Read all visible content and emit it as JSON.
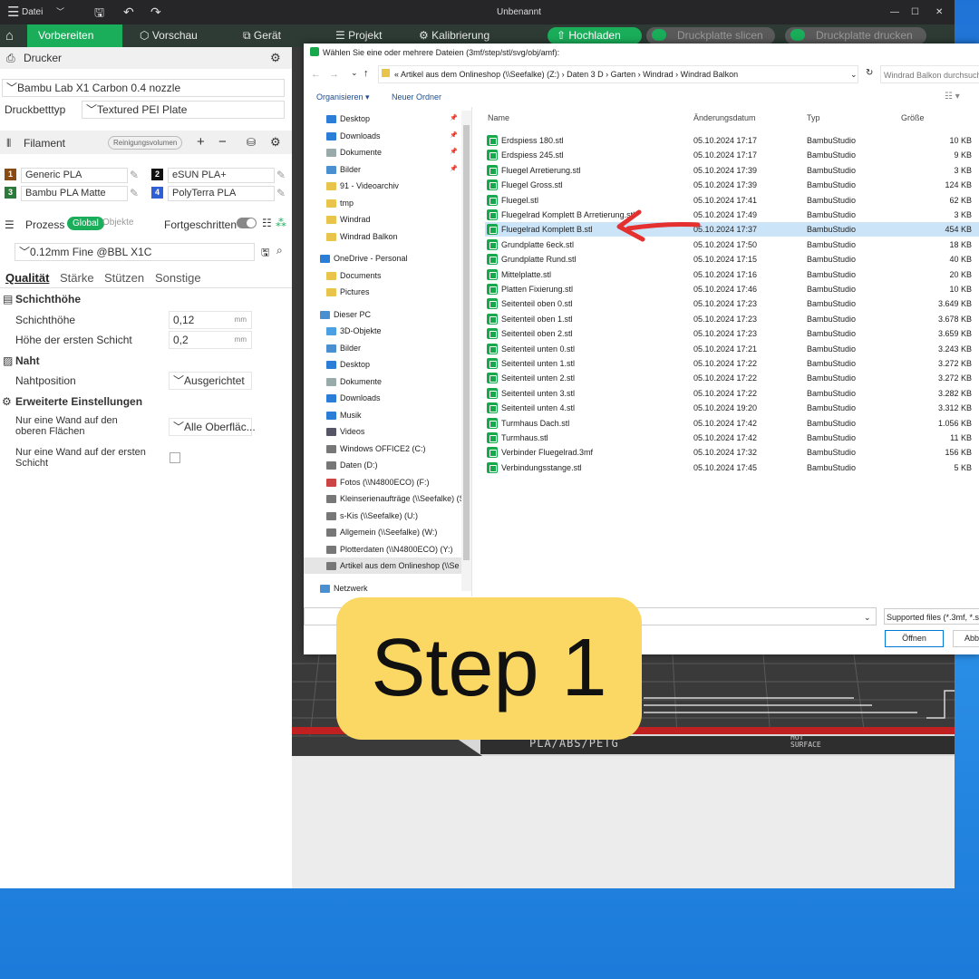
{
  "window": {
    "menu_label": "Datei",
    "title": "Unbenannt"
  },
  "toolbar": {
    "tabs": [
      "Vorbereiten",
      "Vorschau",
      "Gerät",
      "Projekt",
      "Kalibrierung"
    ],
    "upload": "Hochladen",
    "slice": "Druckplatte slicen",
    "print": "Druckplatte drucken"
  },
  "printer": {
    "section": "Drucker",
    "model": "Bambu Lab X1 Carbon 0.4 nozzle",
    "bed_label": "Druckbetttyp",
    "bed_value": "Textured PEI Plate"
  },
  "filament": {
    "section": "Filament",
    "purge": "Reinigungsvolumen",
    "items": [
      {
        "num": "1",
        "name": "Generic PLA",
        "color": "#8a4b12"
      },
      {
        "num": "2",
        "name": "eSUN PLA+",
        "color": "#111111"
      },
      {
        "num": "3",
        "name": "Bambu PLA Matte",
        "color": "#2a7a3a"
      },
      {
        "num": "4",
        "name": "PolyTerra PLA",
        "color": "#2f5fd6"
      }
    ]
  },
  "process": {
    "section": "Prozess",
    "global": "Global",
    "objects": "Objekte",
    "advanced": "Fortgeschritten",
    "preset": "0.12mm Fine @BBL X1C",
    "tabs": [
      "Qualität",
      "Stärke",
      "Stützen",
      "Sonstige"
    ],
    "layer_group": "Schichthöhe",
    "layer_height_label": "Schichthöhe",
    "layer_height": "0,12",
    "first_layer_label": "Höhe der ersten Schicht",
    "first_layer": "0,2",
    "unit": "mm",
    "seam_group": "Naht",
    "seam_label": "Nahtposition",
    "seam_value": "Ausgerichtet",
    "adv_group": "Erweiterte Einstellungen",
    "one_wall_top_label": "Nur eine Wand auf den oberen Flächen",
    "one_wall_top_value": "Alle Oberfläc...",
    "one_wall_first_label": "Nur eine Wand auf der ersten Schicht"
  },
  "plate": {
    "label": "PLA/ABS/PETG",
    "hot": "HOT",
    "surface": "SURFACE"
  },
  "dialog": {
    "title": "Wählen Sie eine oder mehrere Dateien (3mf/step/stl/svg/obj/amf):",
    "breadcrumb": [
      "Artikel aus dem Onlineshop (\\\\Seefalke) (Z:)",
      "Daten 3 D",
      "Garten",
      "Windrad",
      "Windrad Balkon"
    ],
    "search_placeholder": "Windrad Balkon durchsuchen",
    "organize": "Organisieren",
    "new_folder": "Neuer Ordner",
    "columns": [
      "Name",
      "Änderungsdatum",
      "Typ",
      "Größe"
    ],
    "nav": [
      {
        "label": "Desktop",
        "c": "#2a7ed8",
        "i": 0
      },
      {
        "label": "Downloads",
        "c": "#2a7ed8",
        "i": 0
      },
      {
        "label": "Dokumente",
        "c": "#9aa",
        "i": 0
      },
      {
        "label": "Bilder",
        "c": "#4a8fd0",
        "i": 0
      },
      {
        "label": "91 - Videoarchiv",
        "c": "#e8c44a",
        "i": 0
      },
      {
        "label": "tmp",
        "c": "#e8c44a",
        "i": 0
      },
      {
        "label": "Windrad",
        "c": "#e8c44a",
        "i": 0
      },
      {
        "label": "Windrad Balkon",
        "c": "#e8c44a",
        "i": 0
      },
      {
        "label": "",
        "c": "",
        "i": 0
      },
      {
        "label": "OneDrive - Personal",
        "c": "#2a7ed8",
        "i": -1
      },
      {
        "label": "Documents",
        "c": "#e8c44a",
        "i": 0
      },
      {
        "label": "Pictures",
        "c": "#e8c44a",
        "i": 0
      },
      {
        "label": "",
        "c": "",
        "i": 0
      },
      {
        "label": "Dieser PC",
        "c": "#4a8fd0",
        "i": -1
      },
      {
        "label": "3D-Objekte",
        "c": "#4aa0e0",
        "i": 0
      },
      {
        "label": "Bilder",
        "c": "#4a8fd0",
        "i": 0
      },
      {
        "label": "Desktop",
        "c": "#2a7ed8",
        "i": 0
      },
      {
        "label": "Dokumente",
        "c": "#9aa",
        "i": 0
      },
      {
        "label": "Downloads",
        "c": "#2a7ed8",
        "i": 0
      },
      {
        "label": "Musik",
        "c": "#2a7ed8",
        "i": 0
      },
      {
        "label": "Videos",
        "c": "#556",
        "i": 0
      },
      {
        "label": "Windows OFFICE2 (C:)",
        "c": "#777",
        "i": 0
      },
      {
        "label": "Daten (D:)",
        "c": "#777",
        "i": 0
      },
      {
        "label": "Fotos (\\\\N4800ECO) (F:)",
        "c": "#c44",
        "i": 0
      },
      {
        "label": "Kleinserienaufträge (\\\\Seefalke) (S",
        "c": "#777",
        "i": 0
      },
      {
        "label": "s-Kis (\\\\Seefalke) (U:)",
        "c": "#777",
        "i": 0
      },
      {
        "label": "Allgemein (\\\\Seefalke) (W:)",
        "c": "#777",
        "i": 0
      },
      {
        "label": "Plotterdaten (\\\\N4800ECO) (Y:)",
        "c": "#777",
        "i": 0
      },
      {
        "label": "Artikel aus dem Onlineshop (\\\\Se",
        "c": "#777",
        "i": 0
      },
      {
        "label": "",
        "c": "",
        "i": 0
      },
      {
        "label": "Netzwerk",
        "c": "#4a8fd0",
        "i": -1
      }
    ],
    "files": [
      [
        "Erdspiess 180.stl",
        "05.10.2024 17:17",
        "BambuStudio",
        "10 KB"
      ],
      [
        "Erdspiess 245.stl",
        "05.10.2024 17:17",
        "BambuStudio",
        "9 KB"
      ],
      [
        "Fluegel Arretierung.stl",
        "05.10.2024 17:39",
        "BambuStudio",
        "3 KB"
      ],
      [
        "Fluegel Gross.stl",
        "05.10.2024 17:39",
        "BambuStudio",
        "124 KB"
      ],
      [
        "Fluegel.stl",
        "05.10.2024 17:41",
        "BambuStudio",
        "62 KB"
      ],
      [
        "Fluegelrad Komplett B Arretierung.stl",
        "05.10.2024 17:49",
        "BambuStudio",
        "3 KB"
      ],
      [
        "Fluegelrad Komplett B.stl",
        "05.10.2024 17:37",
        "BambuStudio",
        "454 KB"
      ],
      [
        "Grundplatte 6eck.stl",
        "05.10.2024 17:50",
        "BambuStudio",
        "18 KB"
      ],
      [
        "Grundplatte Rund.stl",
        "05.10.2024 17:15",
        "BambuStudio",
        "40 KB"
      ],
      [
        "Mittelplatte.stl",
        "05.10.2024 17:16",
        "BambuStudio",
        "20 KB"
      ],
      [
        "Platten Fixierung.stl",
        "05.10.2024 17:46",
        "BambuStudio",
        "10 KB"
      ],
      [
        "Seitenteil oben 0.stl",
        "05.10.2024 17:23",
        "BambuStudio",
        "3.649 KB"
      ],
      [
        "Seitenteil oben 1.stl",
        "05.10.2024 17:23",
        "BambuStudio",
        "3.678 KB"
      ],
      [
        "Seitenteil oben 2.stl",
        "05.10.2024 17:23",
        "BambuStudio",
        "3.659 KB"
      ],
      [
        "Seitenteil unten 0.stl",
        "05.10.2024 17:21",
        "BambuStudio",
        "3.243 KB"
      ],
      [
        "Seitenteil unten 1.stl",
        "05.10.2024 17:22",
        "BambuStudio",
        "3.272 KB"
      ],
      [
        "Seitenteil unten 2.stl",
        "05.10.2024 17:22",
        "BambuStudio",
        "3.272 KB"
      ],
      [
        "Seitenteil unten 3.stl",
        "05.10.2024 17:22",
        "BambuStudio",
        "3.282 KB"
      ],
      [
        "Seitenteil unten 4.stl",
        "05.10.2024 19:20",
        "BambuStudio",
        "3.312 KB"
      ],
      [
        "Turmhaus Dach.stl",
        "05.10.2024 17:42",
        "BambuStudio",
        "1.056 KB"
      ],
      [
        "Turmhaus.stl",
        "05.10.2024 17:42",
        "BambuStudio",
        "11 KB"
      ],
      [
        "Verbinder Fluegelrad.3mf",
        "05.10.2024 17:32",
        "BambuStudio",
        "156 KB"
      ],
      [
        "Verbindungsstange.stl",
        "05.10.2024 17:45",
        "BambuStudio",
        "5 KB"
      ]
    ],
    "selected_index": 6,
    "filetype": "Supported files (*.3mf, *.s",
    "open": "Öffnen",
    "cancel": "Abb"
  },
  "overlay": {
    "step": "Step 1"
  }
}
